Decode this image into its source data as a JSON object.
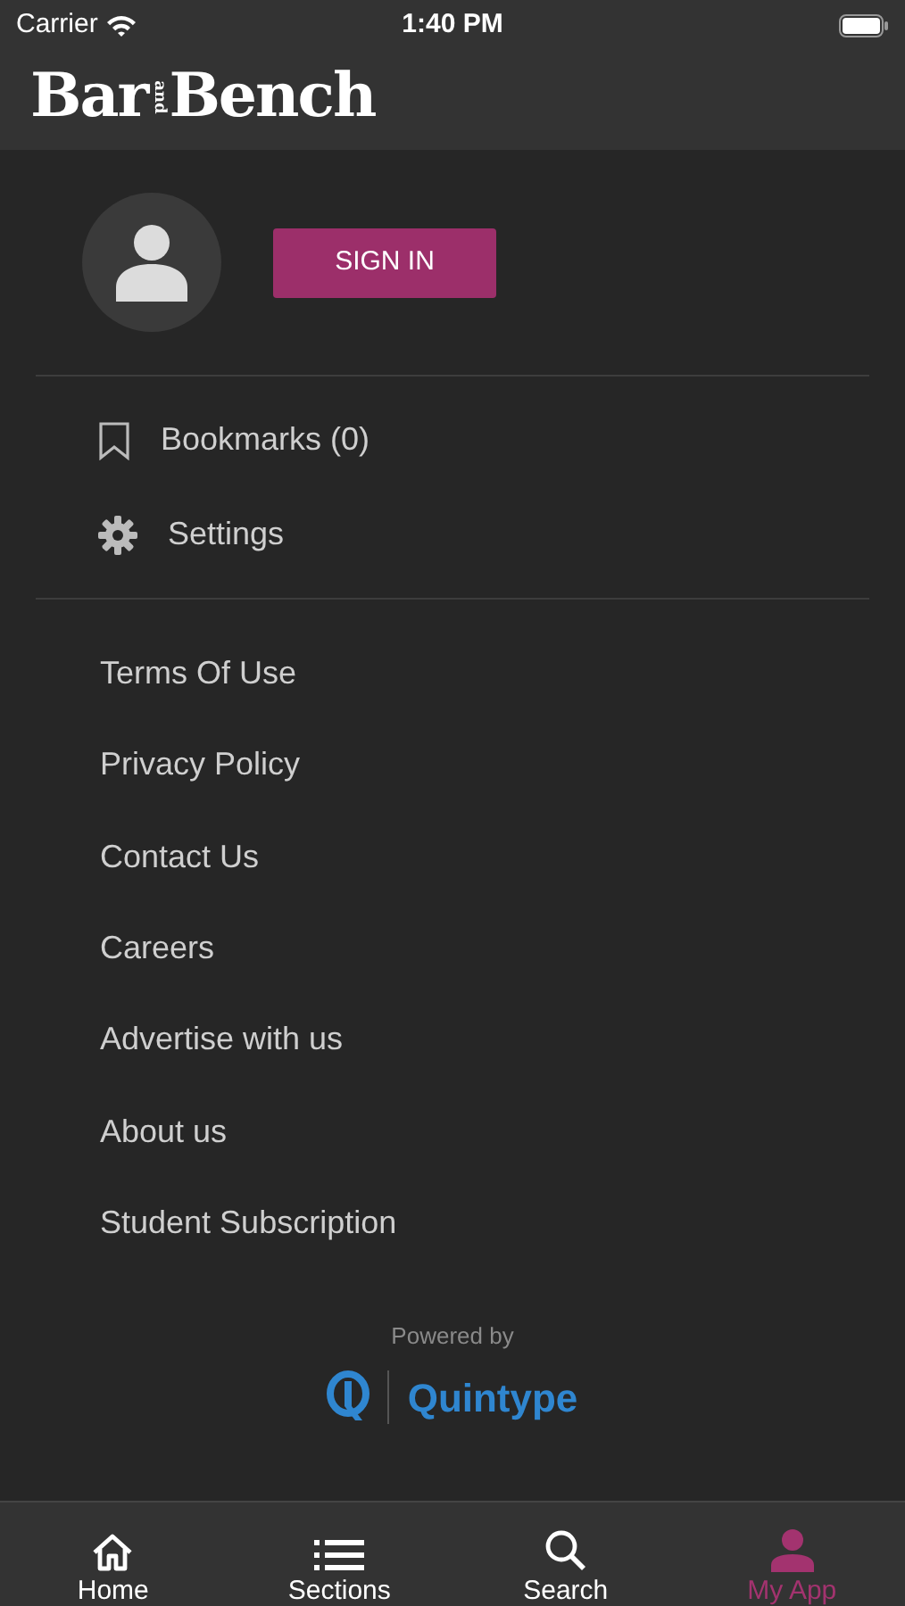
{
  "status_bar": {
    "carrier": "Carrier",
    "time": "1:40 PM"
  },
  "logo": {
    "first": "Bar",
    "middle": "and",
    "last": "Bench"
  },
  "account": {
    "sign_in": "SIGN IN"
  },
  "menu": [
    {
      "kind": "bookmark",
      "label": "Bookmarks (0)"
    },
    {
      "kind": "settings",
      "label": "Settings"
    }
  ],
  "links": [
    "Terms Of Use",
    "Privacy Policy",
    "Contact Us",
    "Careers",
    "Advertise with us",
    "About us",
    "Student Subscription"
  ],
  "footer": {
    "powered_by": "Powered by",
    "brand": "Quintype"
  },
  "tab_bar": [
    {
      "kind": "home",
      "label": "Home",
      "selected": false
    },
    {
      "kind": "sections",
      "label": "Sections",
      "selected": false
    },
    {
      "kind": "search",
      "label": "Search",
      "selected": false
    },
    {
      "kind": "person",
      "label": "My App",
      "selected": true
    }
  ]
}
